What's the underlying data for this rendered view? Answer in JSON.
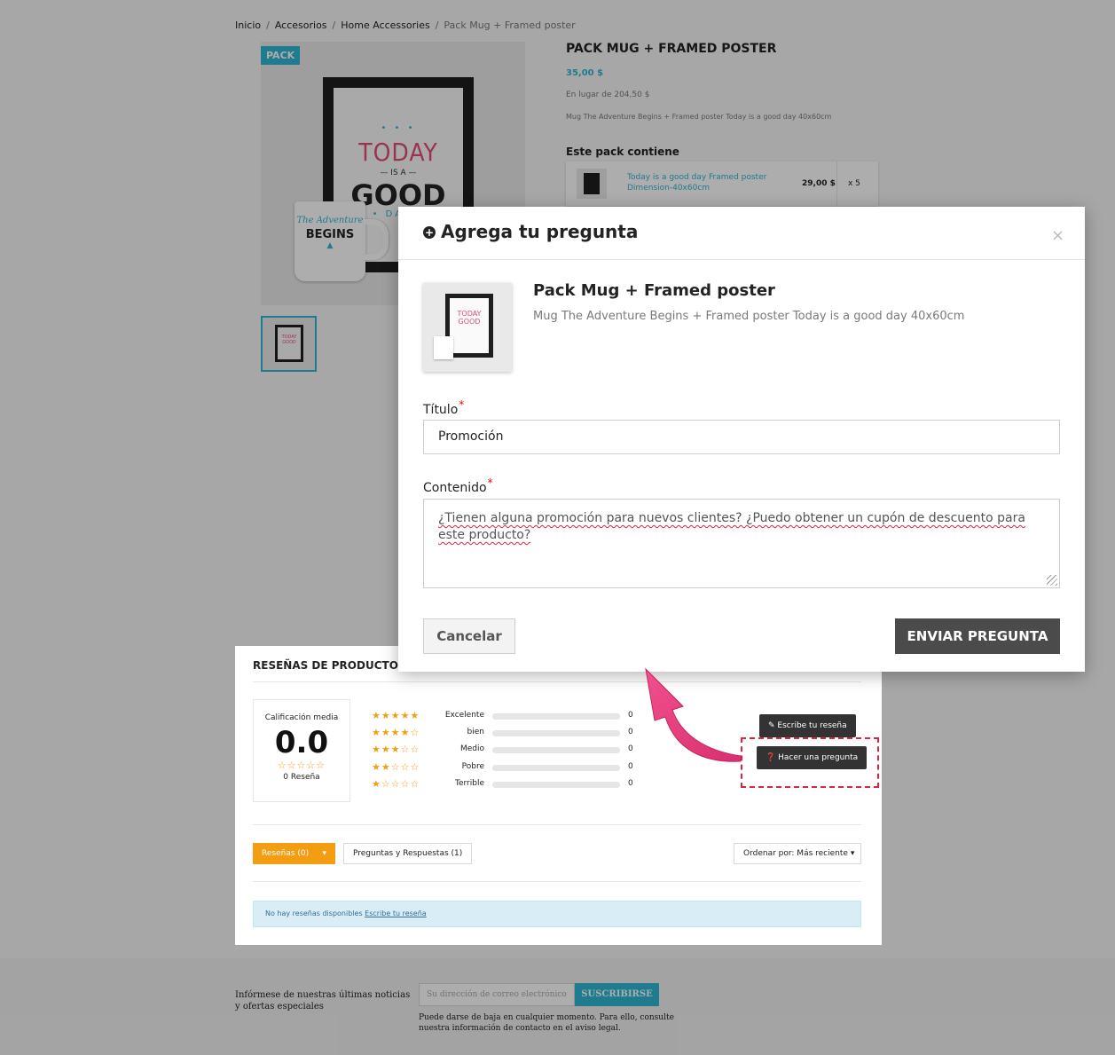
{
  "breadcrumb": {
    "items": [
      "Inicio",
      "Accesorios",
      "Home Accessories"
    ],
    "current": "Pack Mug + Framed poster"
  },
  "product": {
    "badge": "PACK",
    "title": "PACK MUG + FRAMED POSTER",
    "price": "35,00 $",
    "price_instead": "En lugar de 204,50 $",
    "short_description": "Mug The Adventure Begins + Framed poster Today is a good day 40x60cm",
    "pack_heading": "Este pack contiene",
    "pack_items": [
      {
        "name": "Today is a good day Framed poster",
        "attribute": "Dimension-40x60cm",
        "price": "29,00 $",
        "qty": "x 5"
      }
    ]
  },
  "reviews": {
    "title": "RESEÑAS DE PRODUCTOS / Q",
    "average_label": "Calificación media",
    "average_value": "0.0",
    "average_stars": "☆☆☆☆☆",
    "count_label": "0 Reseña",
    "rows": [
      {
        "stars": "★★★★★",
        "label": "Excelente",
        "count": "0",
        "fill": 0
      },
      {
        "stars": "★★★★☆",
        "label": "bien",
        "count": "0",
        "fill": 0
      },
      {
        "stars": "★★★☆☆",
        "label": "Medio",
        "count": "0",
        "fill": 0
      },
      {
        "stars": "★★☆☆☆",
        "label": "Pobre",
        "count": "0",
        "fill": 0
      },
      {
        "stars": "★☆☆☆☆",
        "label": "Terrible",
        "count": "0",
        "fill": 0
      }
    ],
    "write_review_button": "Escribe tu reseña",
    "ask_question_button": "Hacer una pregunta",
    "tab_reviews": "Reseñas (0)",
    "tab_qa": "Preguntas y Respuestas (1)",
    "sort_label": "Ordenar por: Más reciente",
    "no_reviews_text": "No hay reseñas disponibles",
    "no_reviews_link": "Escribe tu reseña"
  },
  "footer": {
    "newsletter_text": "Infórmese de nuestras últimas noticias y ofertas especiales",
    "email_placeholder": "Su dirección de correo electrónico",
    "subscribe_button": "SUSCRIBIRSE",
    "unsubscribe_text": "Puede darse de baja en cualquier momento. Para ello, consulte nuestra información de contacto en el aviso legal."
  },
  "modal": {
    "title": "Agrega tu pregunta",
    "close": "×",
    "product_name": "Pack Mug + Framed poster",
    "product_desc": "Mug The Adventure Begins + Framed poster Today is a good day 40x60cm",
    "title_label": "Título",
    "title_value": "Promoción",
    "content_label": "Contenido",
    "content_value": "¿Tienen alguna promoción para nuevos clientes? ¿Puedo obtener un cupón de descuento para este producto?",
    "cancel_button": "Cancelar",
    "submit_button": "ENVIAR PREGUNTA"
  },
  "colors": {
    "accent": "#2fb5d2",
    "star": "#f39d12",
    "arrow": "#e8407c",
    "highlight_dash": "#e02440"
  }
}
